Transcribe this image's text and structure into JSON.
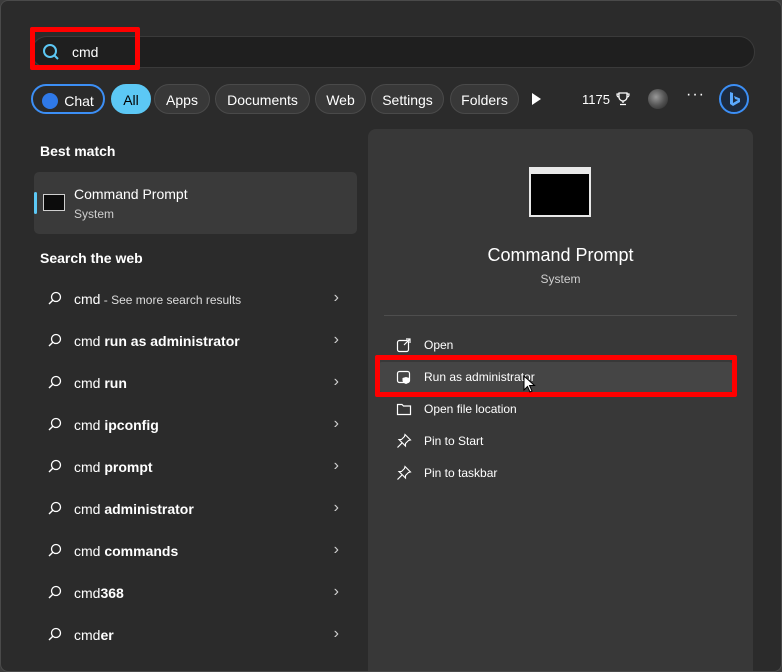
{
  "search": {
    "query": "cmd"
  },
  "filters": {
    "chat": "Chat",
    "all": "All",
    "apps": "Apps",
    "documents": "Documents",
    "web": "Web",
    "settings": "Settings",
    "folders": "Folders",
    "points": "1175"
  },
  "best_match": {
    "heading": "Best match",
    "title": "Command Prompt",
    "subtitle": "System"
  },
  "web": {
    "heading": "Search the web",
    "items": [
      {
        "prefix": "cmd",
        "bold": "",
        "hint": " - See more search results"
      },
      {
        "prefix": "cmd ",
        "bold": "run as administrator",
        "hint": ""
      },
      {
        "prefix": "cmd ",
        "bold": "run",
        "hint": ""
      },
      {
        "prefix": "cmd ",
        "bold": "ipconfig",
        "hint": ""
      },
      {
        "prefix": "cmd ",
        "bold": "prompt",
        "hint": ""
      },
      {
        "prefix": "cmd ",
        "bold": "administrator",
        "hint": ""
      },
      {
        "prefix": "cmd ",
        "bold": "commands",
        "hint": ""
      },
      {
        "prefix": "cmd",
        "bold": "368",
        "hint": ""
      },
      {
        "prefix": "cmd",
        "bold": "er",
        "hint": ""
      }
    ]
  },
  "detail": {
    "title": "Command Prompt",
    "subtitle": "System",
    "actions": {
      "open": "Open",
      "run_admin": "Run as administrator",
      "open_location": "Open file location",
      "pin_start": "Pin to Start",
      "pin_taskbar": "Pin to taskbar"
    }
  },
  "colors": {
    "accent": "#5cc8f5",
    "highlight": "#ff0000",
    "bing": "#3c8ff6"
  }
}
